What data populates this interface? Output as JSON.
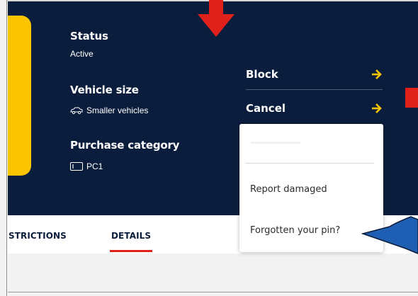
{
  "details": {
    "status": {
      "label": "Status",
      "value": "Active"
    },
    "vehicle_size": {
      "label": "Vehicle size",
      "value": "Smaller vehicles",
      "icon": "car-icon"
    },
    "purchase_category": {
      "label": "Purchase category",
      "value": "PC1",
      "icon": "card-icon"
    }
  },
  "actions": {
    "block_label": "Block",
    "cancel_label": "Cancel",
    "arrow_icon": "arrow-right-icon",
    "arrow_color": "#f5c400"
  },
  "menu": {
    "items": [
      {
        "label": "Report damaged"
      },
      {
        "label": "Forgotten your pin?"
      }
    ]
  },
  "tabs": [
    {
      "label": "STRICTIONS"
    },
    {
      "label": "DETAILS",
      "active": true
    }
  ],
  "colors": {
    "panel": "#0b1d3c",
    "accent_yellow": "#fbc400",
    "accent_red": "#e0201a",
    "callout_blue": "#1f5fb3"
  }
}
